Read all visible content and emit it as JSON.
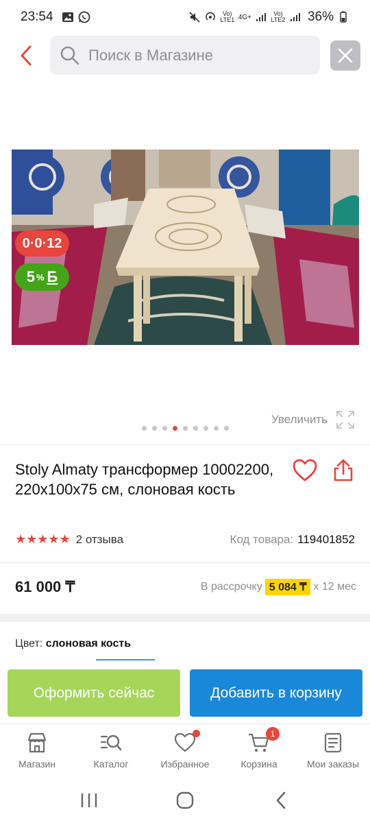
{
  "status_bar": {
    "time": "23:54",
    "battery": "36%",
    "icons": [
      "image-icon",
      "whatsapp-icon",
      "mute-icon",
      "hotspot-icon",
      "volte-lte1-icon",
      "4g-icon",
      "signal-icon",
      "volte-lte2-icon",
      "signal-icon",
      "battery-icon"
    ],
    "lte1_label": "Vo) LTE1",
    "net_label": "4G+",
    "lte2_label": "Vo) LTE2"
  },
  "search": {
    "placeholder": "Поиск в Магазине",
    "value": ""
  },
  "gallery": {
    "timer_badge": "0·0·12",
    "cashback_percent": "5",
    "cashback_suffix": "%",
    "cashback_letter": "Б",
    "zoom_label": "Увеличить",
    "dot_count": 9,
    "active_dot": 3
  },
  "product": {
    "title": "Stoly Almaty трансформер 10002200, 220x100x75 см, слоновая кость",
    "rating": 5,
    "stars": "★★★★★",
    "reviews": "2 отзыва",
    "sku_label": "Код товара:",
    "sku": "119401852",
    "price": "61 000 ₸",
    "installment_label": "В рассрочку",
    "installment_monthly": "5 084 ₸",
    "installment_term": "x 12 мес",
    "color_label": "Цвет:",
    "color_value": "слоновая кость"
  },
  "actions": {
    "buy_now": "Оформить сейчас",
    "add_to_cart": "Добавить в корзину"
  },
  "tabbar": {
    "items": [
      {
        "label": "Магазин",
        "icon": "shop-icon"
      },
      {
        "label": "Каталог",
        "icon": "catalog-search-icon"
      },
      {
        "label": "Избранное",
        "icon": "heart-icon"
      },
      {
        "label": "Корзина",
        "icon": "cart-icon",
        "badge": "1"
      },
      {
        "label": "Мои заказы",
        "icon": "orders-icon"
      }
    ]
  },
  "colors": {
    "accent_red": "#e8453c",
    "cashback_green": "#44a418",
    "buy_green": "#a5d65a",
    "cart_blue": "#1a88d9",
    "installment_yellow": "#ffd500"
  }
}
